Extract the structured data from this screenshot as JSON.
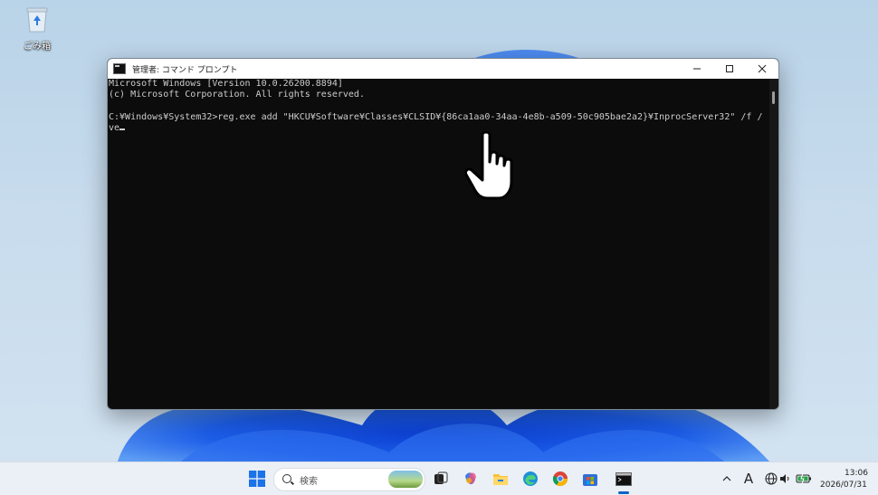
{
  "desktop": {
    "recycle_bin_label": "ごみ箱"
  },
  "window": {
    "title": "管理者: コマンド プロンプト",
    "minimize_icon": "minimize-icon",
    "maximize_icon": "maximize-icon",
    "close_icon": "close-icon"
  },
  "console": {
    "line1": "Microsoft Windows [Version 10.0.26200.8894]",
    "line2": "(c) Microsoft Corporation. All rights reserved.",
    "line3": "",
    "line4": "C:¥Windows¥System32>reg.exe add \"HKCU¥Software¥Classes¥CLSID¥{86ca1aa0-34aa-4e8b-a509-50c905bae2a2}¥InprocServer32\" /f /",
    "line5": "ve"
  },
  "taskbar": {
    "search_placeholder": "検索",
    "ime_indicator": "A",
    "time": "13:06",
    "date": "2026/07/31",
    "icons": [
      "windows-start-icon",
      "search-icon",
      "task-view-icon",
      "copilot-icon",
      "file-explorer-icon",
      "edge-icon",
      "chrome-icon",
      "store-icon",
      "terminal-icon",
      "chevron-up-icon",
      "globe-icon",
      "speaker-icon",
      "battery-icon"
    ]
  },
  "colors": {
    "console_bg": "#0c0c0c",
    "console_text": "#cccccc",
    "accent": "#0a64c8"
  }
}
